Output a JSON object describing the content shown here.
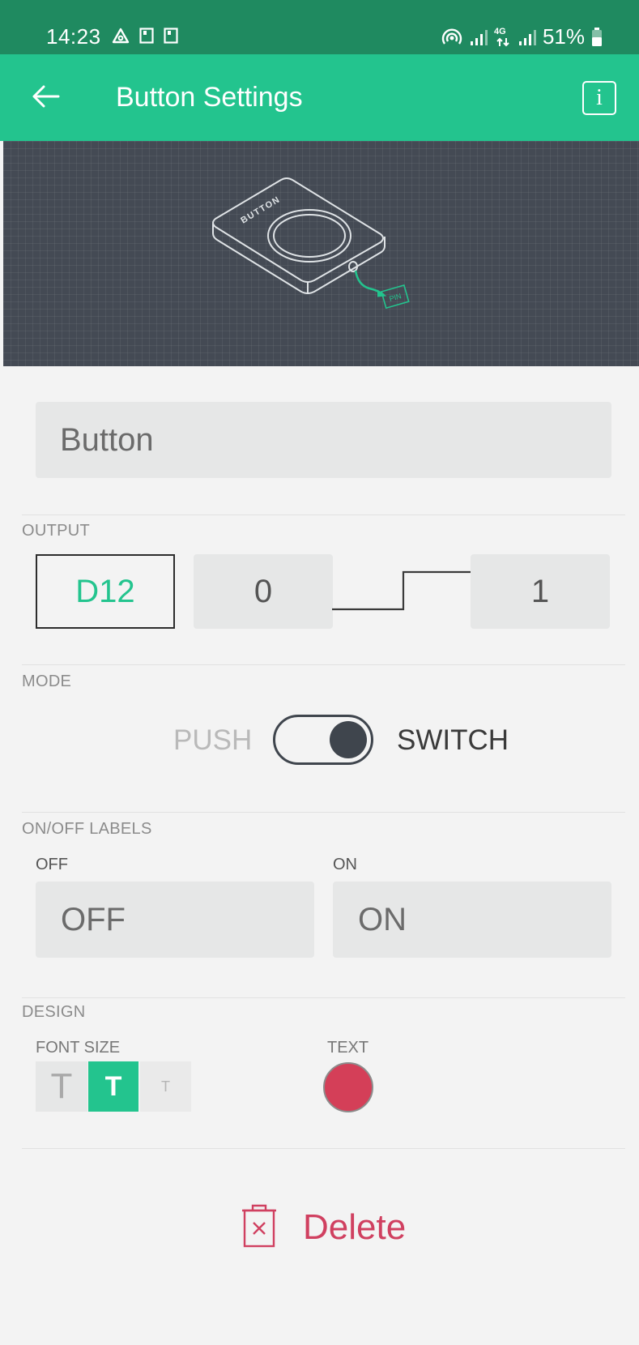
{
  "status_bar": {
    "time": "14:23",
    "network": "4G",
    "battery": "51%",
    "icons": [
      "alert-triangle-icon",
      "notification-icon",
      "notification-icon",
      "hotspot-icon",
      "signal-icon",
      "network-icon",
      "signal-icon",
      "battery-icon"
    ]
  },
  "app_bar": {
    "title": "Button Settings",
    "back_icon": "arrow-left-icon",
    "info_icon": "info-icon"
  },
  "illustration": {
    "device_label": "BUTTON",
    "pin_label": "PIN"
  },
  "name_field": {
    "value": "Button"
  },
  "output": {
    "section_label": "OUTPUT",
    "pin": "D12",
    "low_value": "0",
    "high_value": "1"
  },
  "mode": {
    "section_label": "MODE",
    "push_label": "PUSH",
    "switch_label": "SWITCH",
    "selected": "SWITCH"
  },
  "labels": {
    "section_label": "ON/OFF LABELS",
    "off_caption": "OFF",
    "off_value": "OFF",
    "on_caption": "ON",
    "on_value": "ON"
  },
  "design": {
    "section_label": "DESIGN",
    "font_size_label": "FONT SIZE",
    "font_sizes": [
      "T",
      "T",
      "T"
    ],
    "selected_font_size_index": 1,
    "text_color_label": "TEXT",
    "text_color": "#d43f58"
  },
  "delete": {
    "label": "Delete",
    "icon": "trash-icon"
  },
  "colors": {
    "status_bar": "#1f8a60",
    "app_bar": "#23c48e",
    "accent": "#23c48e",
    "delete": "#d04060"
  }
}
